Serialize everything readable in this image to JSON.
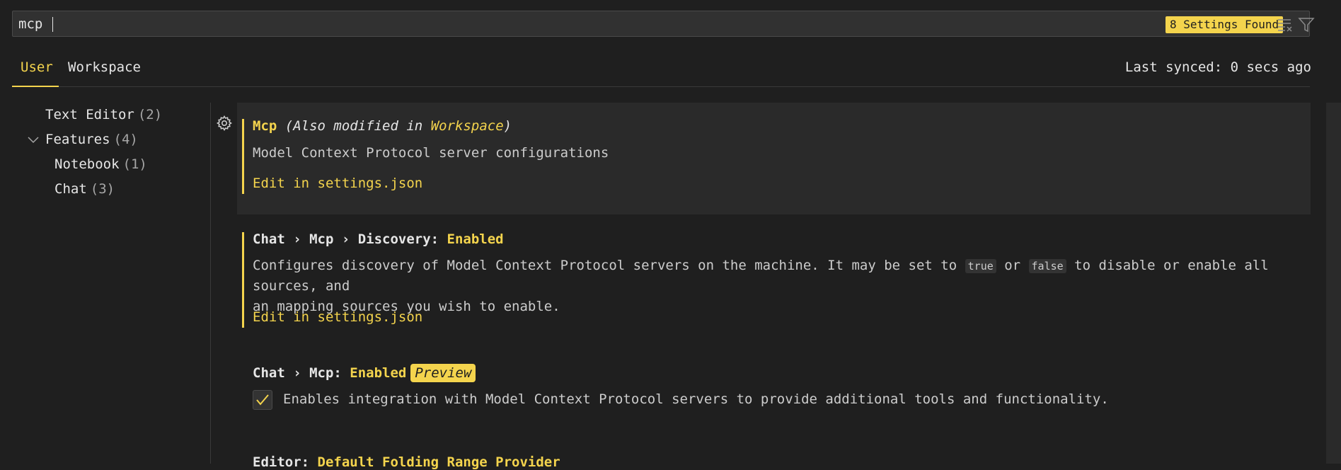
{
  "search": {
    "value": "mcp",
    "found_label": "8 Settings Found",
    "clear_icon": "clear-filter-icon",
    "filter_icon": "filter-icon"
  },
  "tabs": [
    {
      "label": "User",
      "active": true
    },
    {
      "label": "Workspace",
      "active": false
    }
  ],
  "sync_status": "Last synced: 0 secs ago",
  "toc": [
    {
      "label": "Text Editor",
      "count": "(2)"
    },
    {
      "label": "Features",
      "count": "(4)",
      "expanded": true
    },
    {
      "label": "Notebook",
      "count": "(1)"
    },
    {
      "label": "Chat",
      "count": "(3)"
    }
  ],
  "settings": {
    "s1": {
      "name": "Mcp",
      "modified_prefix": "(Also modified in ",
      "modified_scope": "Workspace",
      "modified_suffix": ")",
      "description": "Model Context Protocol server configurations",
      "edit_label": "Edit in settings.json"
    },
    "s2": {
      "category": "Chat › Mcp › Discovery: ",
      "name": "Enabled",
      "desc_1": "Configures discovery of Model Context Protocol servers on the machine. It may be set to ",
      "code_1": "true",
      "desc_2": " or ",
      "code_2": "false",
      "desc_3": " to disable or enable all sources, and",
      "desc_line2": "an mapping sources you wish to enable.",
      "edit_label": "Edit in settings.json"
    },
    "s3": {
      "category": "Chat › Mcp: ",
      "name": "Enabled",
      "badge": "Preview",
      "checked": true,
      "checkbox_label": "Enables integration with Model Context Protocol servers to provide additional tools and functionality."
    },
    "s4": {
      "category": "Editor: ",
      "name": "Default Folding Range Provider"
    }
  },
  "colors": {
    "accent": "#f4d44d",
    "background": "#1f1f1f",
    "text": "#cccccc"
  }
}
